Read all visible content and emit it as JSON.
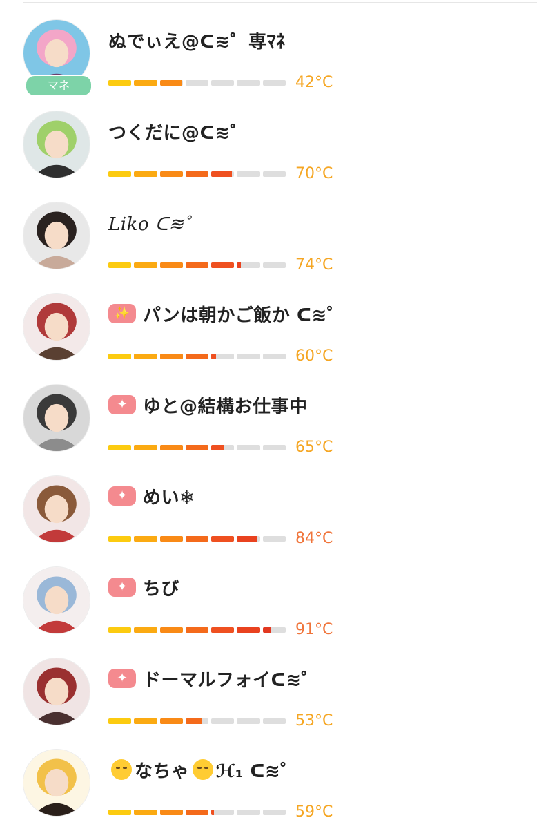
{
  "segment_count": 7,
  "segment_colors": [
    "#fccb10",
    "#fbaa12",
    "#f98a16",
    "#f46a1b",
    "#ef5020",
    "#e9421f",
    "#e23820"
  ],
  "temp_colors": {
    "warm": "#f5a623",
    "hot": "#f0743a"
  },
  "users": [
    {
      "name": "ぬでぃえ@ᑕ≋゜専ﾏﾈ",
      "temperature": 42,
      "temperature_label": "42°C",
      "role_badge": "マネ",
      "sparkle": false,
      "avatar": "avatar-anime-pink-hair",
      "palette": [
        "#7fc6e6",
        "#f3a6c8",
        "#6b3f6e"
      ]
    },
    {
      "name": "つくだに@ᑕ≋゜",
      "temperature": 70,
      "temperature_label": "70°C",
      "sparkle": false,
      "avatar": "avatar-anime-green-hood",
      "palette": [
        "#dfe7e7",
        "#9fd06a",
        "#2f2f2f"
      ]
    },
    {
      "name": "Liko ᑕ≋゜",
      "temperature": 74,
      "temperature_label": "74°C",
      "sparkle": false,
      "italic": true,
      "avatar": "avatar-dark-hair",
      "palette": [
        "#e8e8e8",
        "#2a2220",
        "#c8aa9a"
      ]
    },
    {
      "name": "パンは朝かご飯か ᑕ≋゜",
      "temperature": 60,
      "temperature_label": "60°C",
      "sparkle": true,
      "sparkle_icon": "✨",
      "avatar": "avatar-group-red",
      "palette": [
        "#f3e9e9",
        "#b03a3a",
        "#5a4032"
      ]
    },
    {
      "name": "ゆと@結構お仕事中",
      "temperature": 65,
      "temperature_label": "65°C",
      "sparkle": true,
      "sparkle_icon": "✦",
      "avatar": "avatar-monochrome",
      "palette": [
        "#d8d8d8",
        "#3a3a3a",
        "#8c8c8c"
      ]
    },
    {
      "name": "めい❄",
      "temperature": 84,
      "temperature_label": "84°C",
      "sparkle": true,
      "sparkle_icon": "✦",
      "avatar": "avatar-group-brown",
      "palette": [
        "#f2e6e6",
        "#8a5a3a",
        "#c23a3a"
      ]
    },
    {
      "name": "ちび",
      "temperature": 91,
      "temperature_label": "91°C",
      "sparkle": true,
      "sparkle_icon": "✦",
      "avatar": "avatar-group-white",
      "palette": [
        "#f4eeee",
        "#9ab8d8",
        "#c23a3a"
      ]
    },
    {
      "name": "ドーマルフォイᑕ≋゜",
      "temperature": 53,
      "temperature_label": "53°C",
      "sparkle": true,
      "sparkle_icon": "✦",
      "avatar": "avatar-group-crimson",
      "palette": [
        "#f0e4e4",
        "#9a3030",
        "#4a3030"
      ]
    },
    {
      "name_parts": [
        "😉",
        "なちゃ",
        "😌",
        "ℋ₁ ᑕ≋゜"
      ],
      "temperature": 59,
      "temperature_label": "59°C",
      "sparkle": false,
      "avatar": "avatar-chibi-orange",
      "palette": [
        "#fdf6e3",
        "#f2c14a",
        "#2a1f1a"
      ]
    }
  ]
}
